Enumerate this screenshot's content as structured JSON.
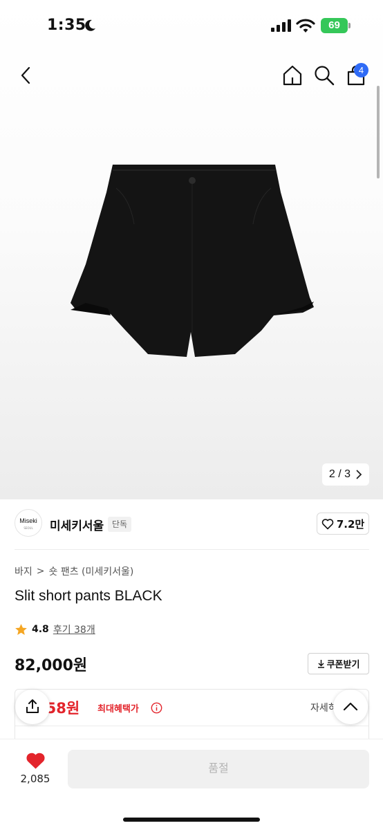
{
  "status_bar": {
    "time": "1:35",
    "battery": "69",
    "battery_color": "#35c759",
    "icons": [
      "moon-icon",
      "cellular-signal-icon",
      "wifi-icon",
      "battery-icon"
    ]
  },
  "header": {
    "icons": [
      "back-arrow-icon",
      "home-icon",
      "search-icon",
      "shopping-bag-icon"
    ],
    "cart_badge": "4",
    "badge_color": "#2f6bf6"
  },
  "gallery": {
    "current": "2",
    "separator": "/",
    "total": "3"
  },
  "brand": {
    "logo_text": "Miseki",
    "logo_subtext": "SEOUL",
    "name": "미세키서울",
    "badge": "단독",
    "likes": "7.2만"
  },
  "breadcrumb": {
    "category": "바지",
    "separator": ">",
    "subcategory": "숏 팬츠 (미세키서울)"
  },
  "product": {
    "title": "Slit short pants BLACK",
    "rating": "4.8",
    "reviews": "후기 38개",
    "price": "82,000원",
    "coupon_label": "쿠폰받기"
  },
  "benefit": {
    "price": "058원",
    "label": "최대혜택가",
    "details": "자세히",
    "accent_color": "#e3242b"
  },
  "bottom_bar": {
    "wish_count": "2,085",
    "buy_label": "품절"
  }
}
